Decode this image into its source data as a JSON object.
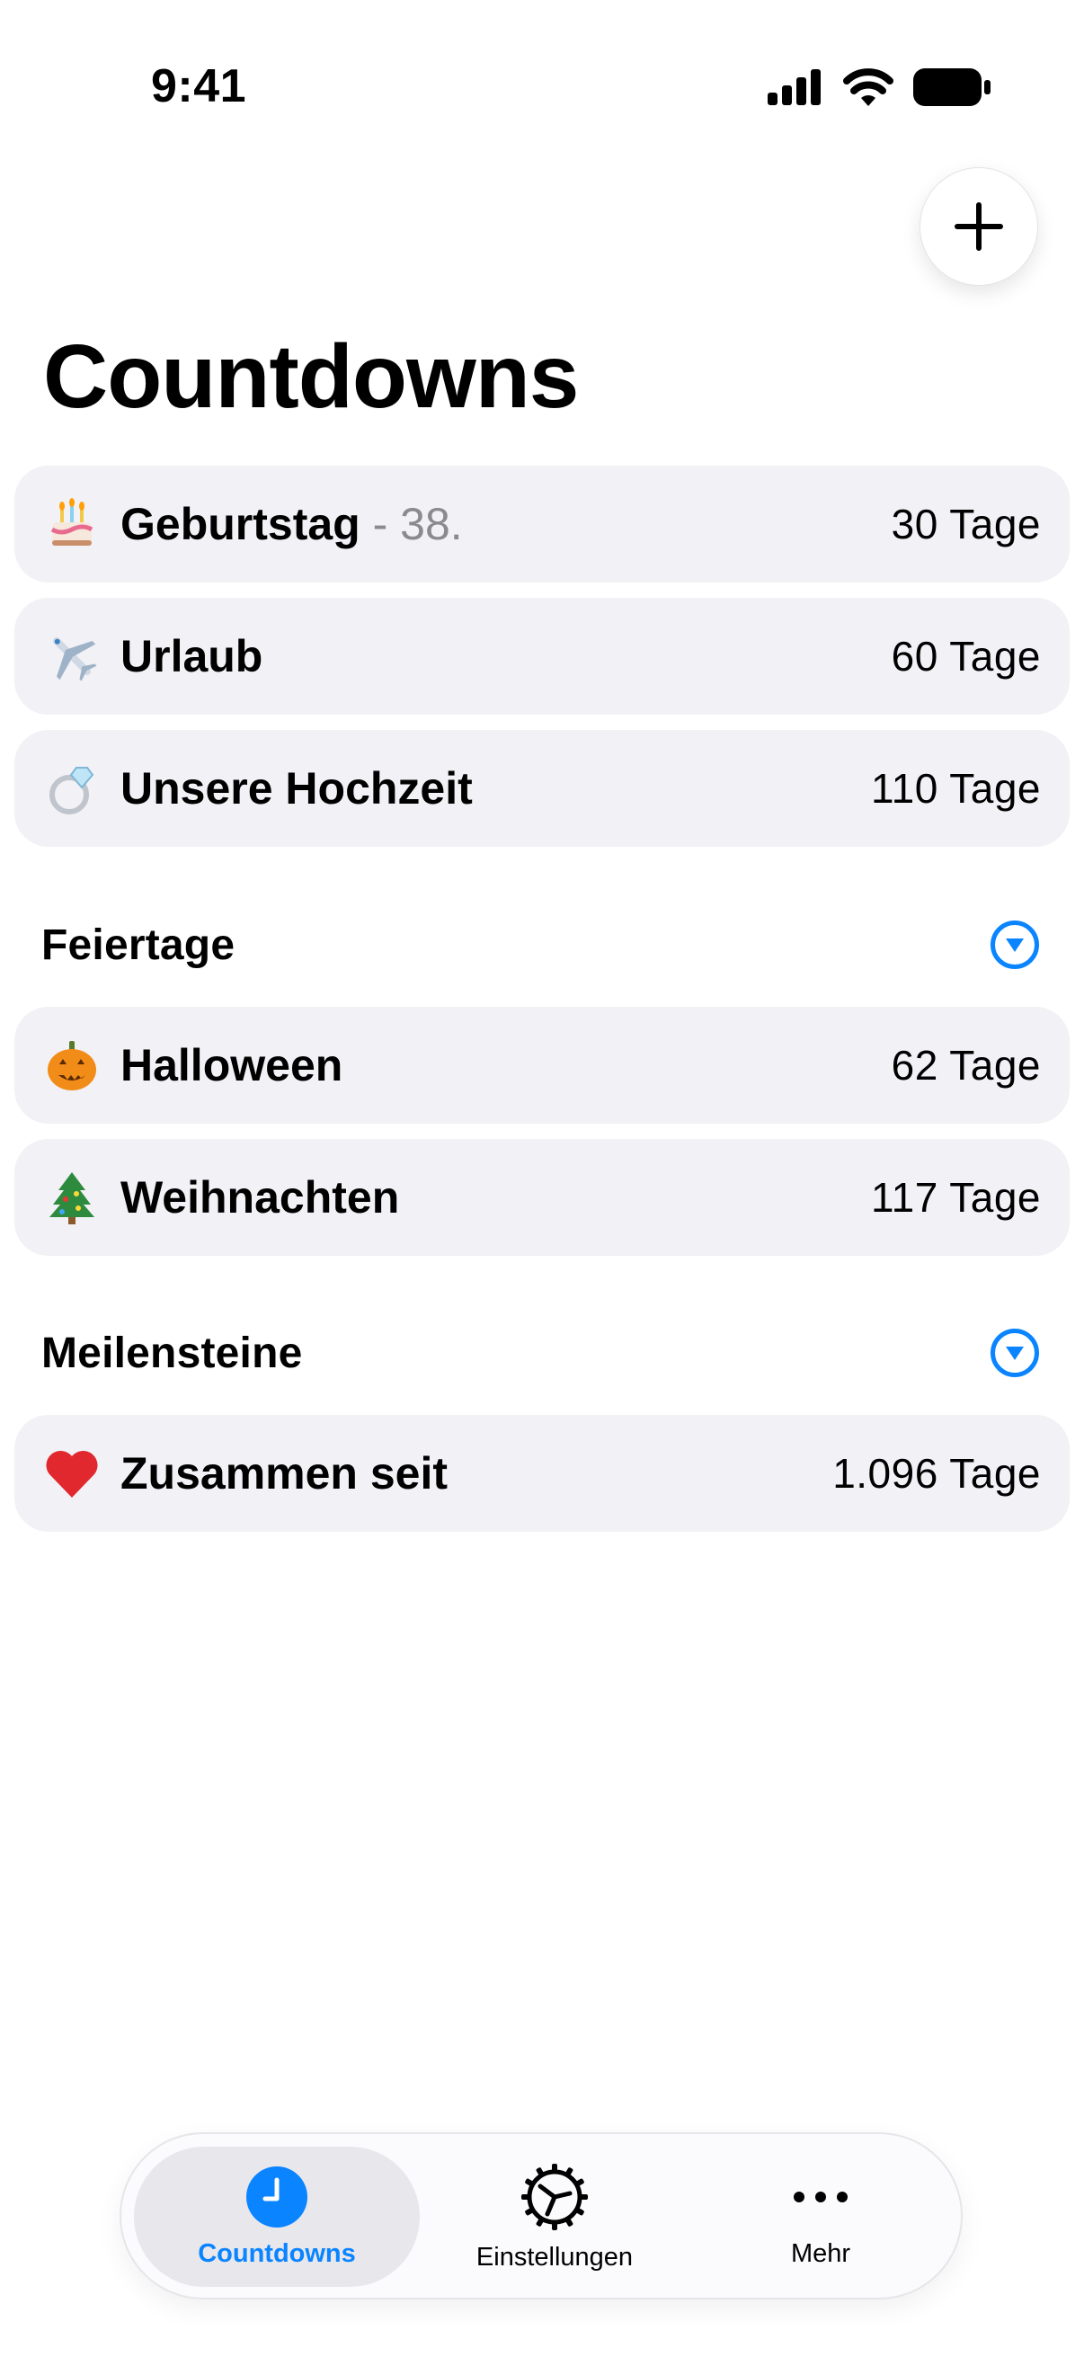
{
  "status": {
    "time": "9:41"
  },
  "page": {
    "title": "Countdowns"
  },
  "countdowns": [
    {
      "emoji": "🎂",
      "icon": "cake-icon",
      "title": "Geburtstag",
      "subtitle": " - 38.",
      "value": "30 Tage"
    },
    {
      "emoji": "✈️",
      "icon": "airplane-icon",
      "title": "Urlaub",
      "subtitle": "",
      "value": "60 Tage"
    },
    {
      "emoji": "💍",
      "icon": "ring-icon",
      "title": "Unsere Hochzeit",
      "subtitle": "",
      "value": "110 Tage"
    }
  ],
  "sections": [
    {
      "header": "Feiertage",
      "items": [
        {
          "emoji": "🎃",
          "icon": "pumpkin-icon",
          "title": "Halloween",
          "value": "62 Tage"
        },
        {
          "emoji": "🎄",
          "icon": "christmas-tree-icon",
          "title": "Weihnachten",
          "value": "117 Tage"
        }
      ]
    },
    {
      "header": "Meilensteine",
      "items": [
        {
          "emoji": "❤️",
          "icon": "heart-icon",
          "title": "Zusammen seit",
          "value": "1.096 Tage"
        }
      ]
    }
  ],
  "tabbar": {
    "tabs": [
      {
        "label": "Countdowns",
        "icon": "clock-icon",
        "active": true
      },
      {
        "label": "Einstellungen",
        "icon": "gear-icon",
        "active": false
      },
      {
        "label": "Mehr",
        "icon": "more-icon",
        "active": false
      }
    ]
  },
  "colors": {
    "accent": "#0a84ff",
    "row_bg": "#f1f1f6",
    "secondary_text": "#8a8a8f"
  }
}
